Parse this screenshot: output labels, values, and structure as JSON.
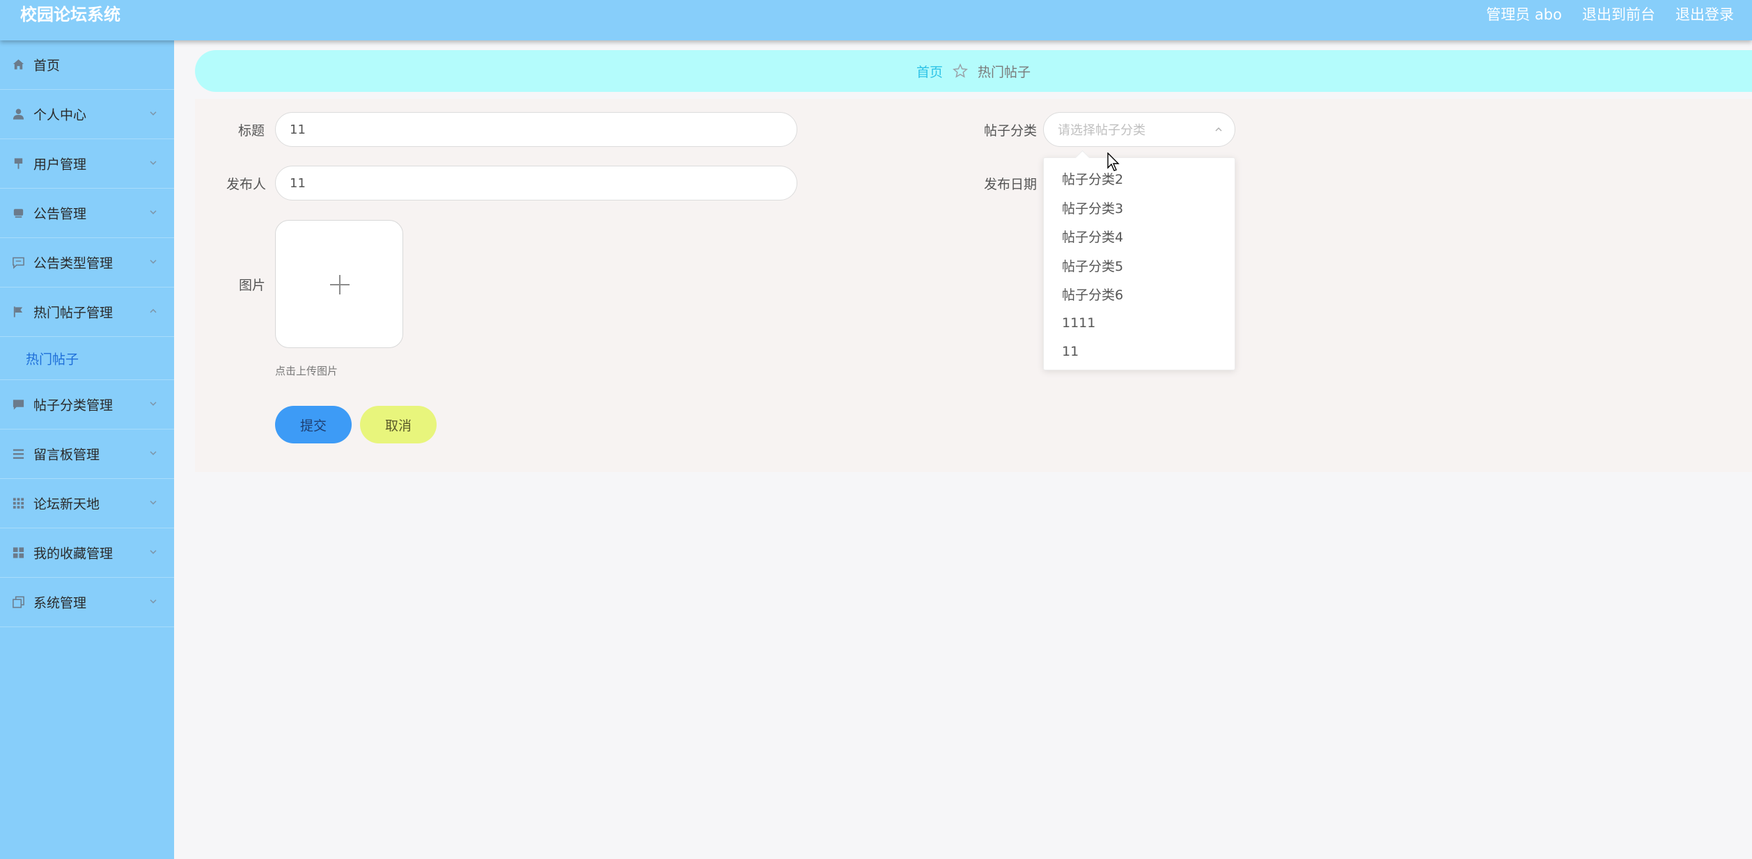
{
  "app": {
    "title": "校园论坛系统"
  },
  "topbar": {
    "user": "管理员 abo",
    "to_front": "退出到前台",
    "logout": "退出登录"
  },
  "sidebar": {
    "items": [
      {
        "label": "首页",
        "icon": "home-icon"
      },
      {
        "label": "个人中心",
        "icon": "user-icon"
      },
      {
        "label": "用户管理",
        "icon": "pin-icon"
      },
      {
        "label": "公告管理",
        "icon": "inbox-icon"
      },
      {
        "label": "公告类型管理",
        "icon": "chat-icon"
      },
      {
        "label": "热门帖子管理",
        "icon": "flag-icon",
        "expanded": true
      },
      {
        "label": "帖子分类管理",
        "icon": "message-icon"
      },
      {
        "label": "留言板管理",
        "icon": "list-icon"
      },
      {
        "label": "论坛新天地",
        "icon": "grid-icon"
      },
      {
        "label": "我的收藏管理",
        "icon": "apps-icon"
      },
      {
        "label": "系统管理",
        "icon": "copy-icon"
      }
    ],
    "sub_active": "热门帖子"
  },
  "breadcrumb": {
    "home": "首页",
    "current": "热门帖子"
  },
  "form": {
    "title_label": "标题",
    "title_value": "11",
    "author_label": "发布人",
    "author_value": "11",
    "image_label": "图片",
    "upload_hint": "点击上传图片",
    "category_label": "帖子分类",
    "category_placeholder": "请选择帖子分类",
    "date_label": "发布日期",
    "submit": "提交",
    "cancel": "取消"
  },
  "dropdown": {
    "options": [
      "帖子分类2",
      "帖子分类3",
      "帖子分类4",
      "帖子分类5",
      "帖子分类6",
      "1111",
      "11"
    ]
  },
  "colors": {
    "header_bg": "#87cefa",
    "breadcrumb_bg": "#b4fcfc",
    "submit_bg": "#3d9bf6",
    "cancel_bg": "#e8f57c"
  }
}
